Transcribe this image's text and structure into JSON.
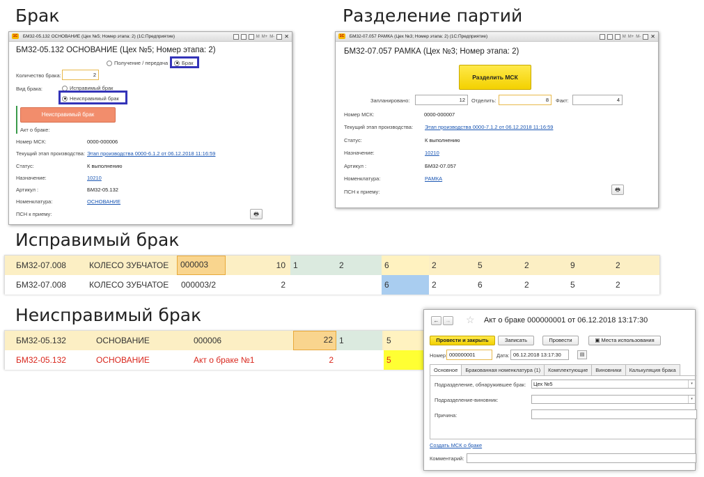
{
  "sections": {
    "brak": "Брак",
    "split": "Разделение партий",
    "fixable": "Исправимый брак",
    "unfixable": "Неисправимый брак"
  },
  "win1": {
    "title": "БМ32-05.132 ОСНОВАНИЕ (Цех №5; Номер этапа: 2) (1С:Предприятие)",
    "form_title": "БМ32-05.132 ОСНОВАНИЕ (Цех №5; Номер этапа: 2)",
    "radio_receive": "Получение / передача",
    "radio_defect": "Брак",
    "qty_label": "Количество брака:",
    "qty_value": "2",
    "kind_label": "Вид брака:",
    "kind_fixable": "Исправимый брак",
    "kind_unfixable": "Неисправимый брак",
    "unfixable_button": "Неисправимый брак",
    "act_label": "Акт о браке:",
    "msk_label": "Номер МСК:",
    "msk_value": "0000-000006",
    "stage_label": "Текущий этап производства:",
    "stage_value": "Этап производства 0000-6.1.2 от 06.12.2018 11:16:59",
    "status_label": "Статус:",
    "status_value": "К выполнению",
    "dest_label": "Назначение:",
    "dest_value": "10210",
    "article_label": "Артикул :",
    "article_value": "БМ32-05.132",
    "nomen_label": "Номенклатура:",
    "nomen_value": "ОСНОВАНИЕ",
    "psn_label": "ПСН к приему:"
  },
  "win2": {
    "title": "БМ32-07.057 РАМКА (Цех №3; Номер этапа: 2) (1С:Предприятие)",
    "form_title": "БМ32-07.057 РАМКА (Цех №3; Номер этапа: 2)",
    "split_button": "Разделить МСК",
    "planned_label": "Запланировано:",
    "planned_value": "12",
    "sep_label": "Отделить:",
    "sep_value": "8",
    "fact_label": "Факт:",
    "fact_value": "4",
    "msk_label": "Номер МСК:",
    "msk_value": "0000-000007",
    "stage_label": "Текущий этап производства:",
    "stage_value": "Этап производства 0000-7.1.2 от 06.12.2018 11:16:59",
    "status_label": "Статус:",
    "status_value": "К выполнению",
    "dest_label": "Назначение:",
    "dest_value": "10210",
    "article_label": "Артикул :",
    "article_value": "БМ32-07.057",
    "nomen_label": "Номенклатура:",
    "nomen_value": "РАМКА",
    "psn_label": "ПСН к приему:"
  },
  "fixable_rows": [
    [
      "БМ32-07.008",
      "КОЛЕСО ЗУБЧАТОЕ",
      "000003",
      "10",
      "1",
      "2",
      "6",
      "2",
      "5",
      "2",
      "9",
      "2"
    ],
    [
      "БМ32-07.008",
      "КОЛЕСО ЗУБЧАТОЕ",
      "000003/2",
      "2",
      "",
      "",
      "6",
      "2",
      "6",
      "2",
      "5",
      "2"
    ]
  ],
  "unfixable_rows": [
    [
      "БМ32-05.132",
      "ОСНОВАНИЕ",
      "000006",
      "22",
      "1",
      "5"
    ],
    [
      "БМ32-05.132",
      "ОСНОВАНИЕ",
      "Акт о браке №1",
      "2",
      "",
      "5"
    ]
  ],
  "act": {
    "title": "Акт о браке 000000001 от 06.12.2018 13:17:30",
    "btn_post_close": "Провести и закрыть",
    "btn_save": "Записать",
    "btn_post": "Провести",
    "btn_usage": "Места использования",
    "number_label": "Номер:",
    "number_value": "000000001",
    "date_label": "Дата:",
    "date_value": "06.12.2018 13:17:30",
    "tabs": [
      "Основное",
      "Бракованная номенклатура (1)",
      "Комплектующие",
      "Виновники",
      "Калькуляция брака"
    ],
    "found_label": "Подразделение, обнаружившее брак:",
    "found_value": "Цех №5",
    "culprit_label": "Подразделение-виновник:",
    "reason_label": "Причина:",
    "create_msk": "Создать МСК о браке",
    "comment_label": "Комментарий:"
  },
  "colors": {
    "yellow_row": "#fcefc4",
    "orange_cell": "#f9d58e",
    "green_cell": "#dbeadf",
    "blue_cell": "#a9cdf0",
    "bright_yellow": "#ffff33",
    "red_text": "#d9261c",
    "salmon_button": "#f28d6c",
    "highlight_blue": "#3333b8"
  }
}
